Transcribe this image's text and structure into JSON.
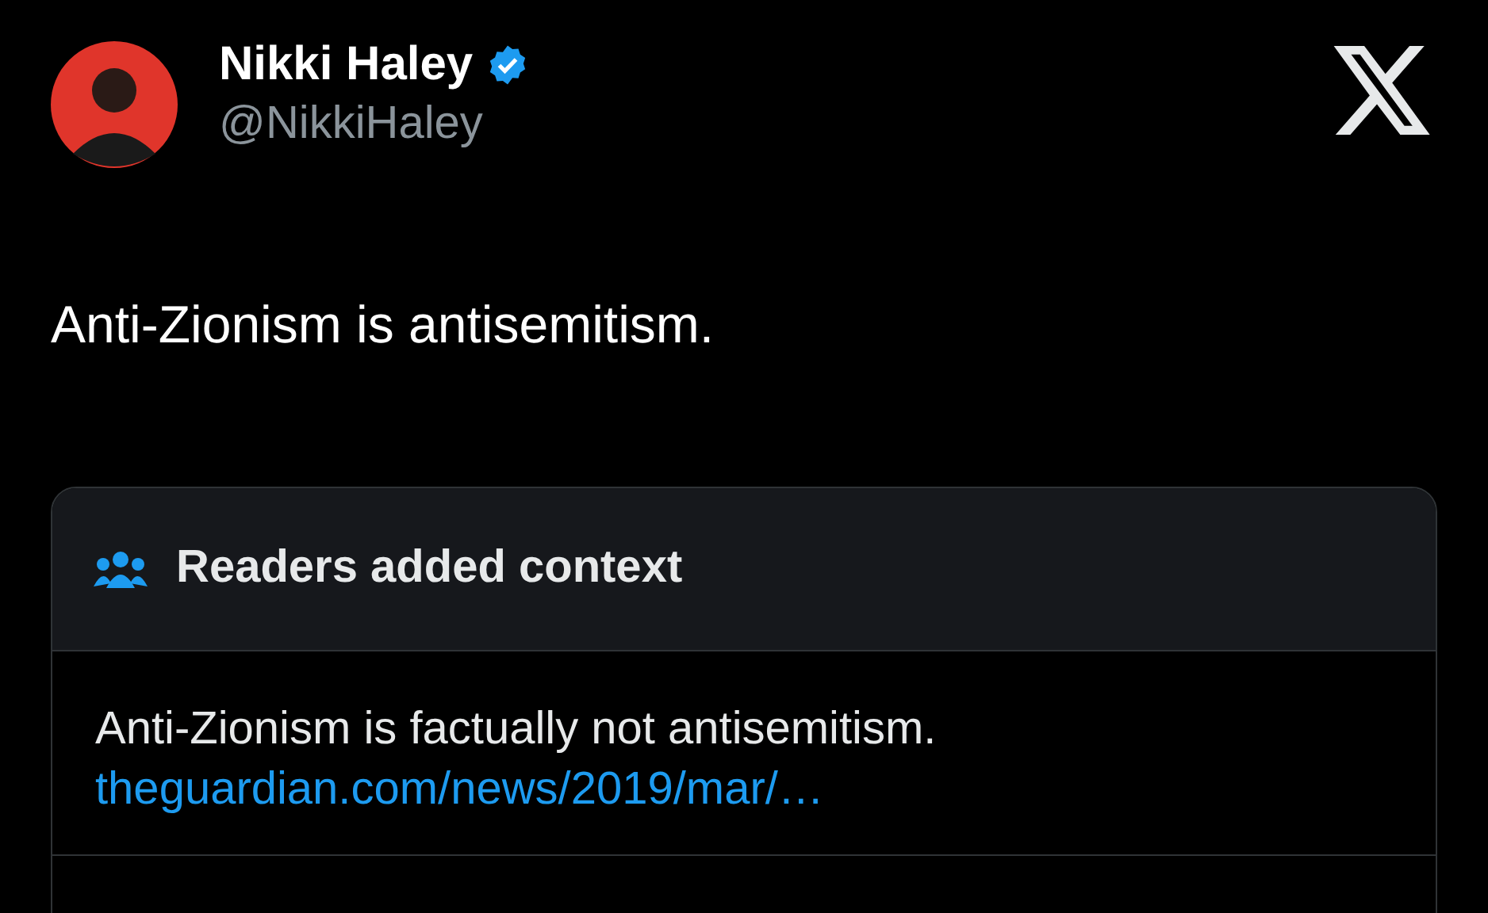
{
  "author": {
    "name": "Nikki Haley",
    "handle": "@NikkiHaley",
    "verified": true
  },
  "text": "Anti-Zionism is antisemitism.",
  "context_note": {
    "title": "Readers added context",
    "text": "Anti-Zionism is factually not antisemitism.",
    "link": "theguardian.com/news/2019/mar/…"
  }
}
